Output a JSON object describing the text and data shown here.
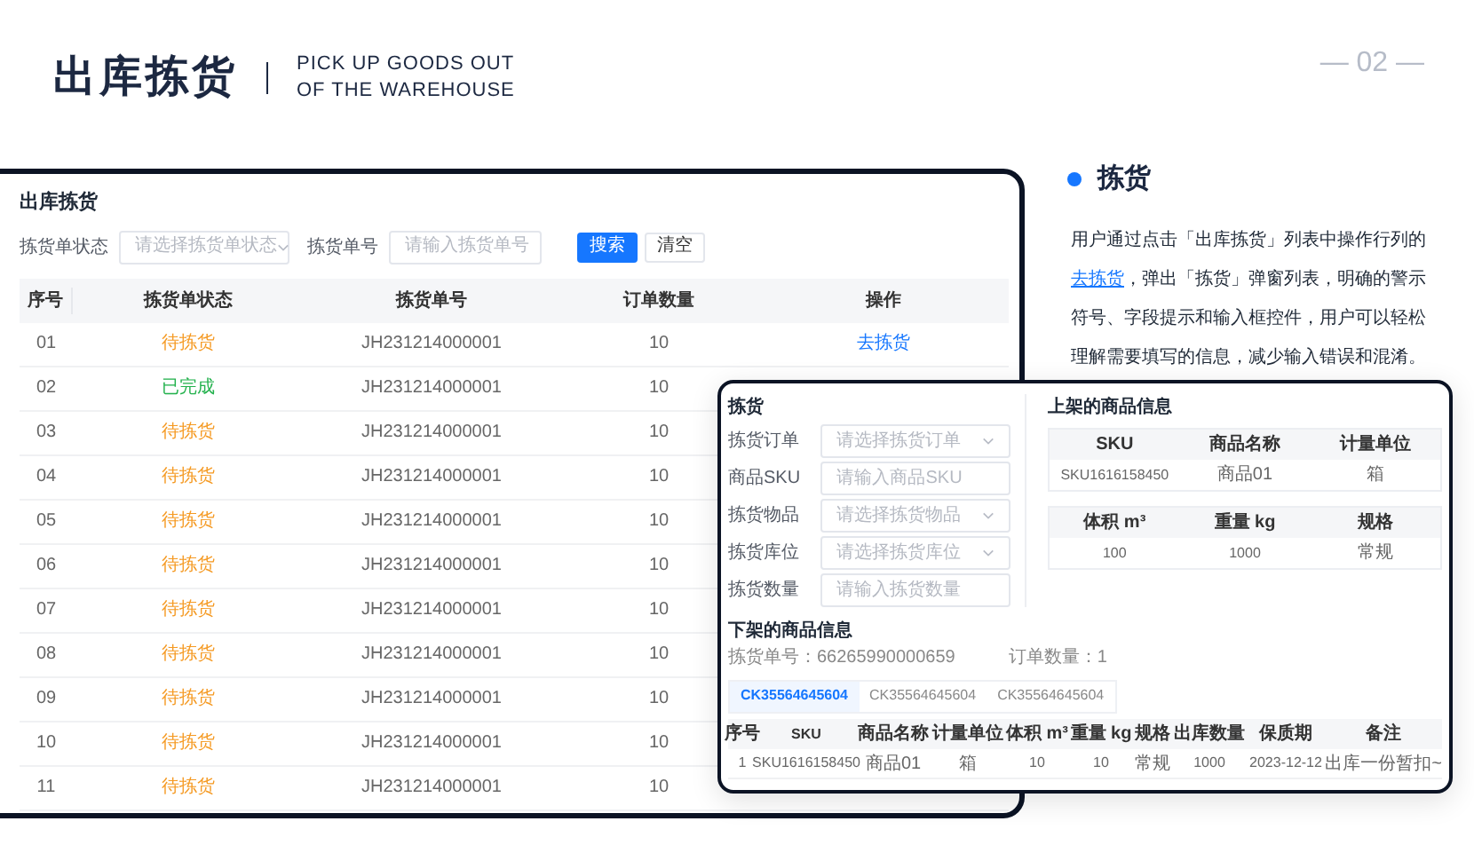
{
  "header": {
    "title": "出库拣货",
    "subtitle_lines": [
      "PICK UP GOODS OUT",
      "OF THE WAREHOUSE"
    ],
    "page_number": "— 02 —"
  },
  "list_window": {
    "title": "出库拣货",
    "filters": [
      {
        "kind": "select",
        "label": "拣货单状态",
        "placeholder": "请选择拣货单状态"
      },
      {
        "kind": "input",
        "label": "拣货单号",
        "placeholder": "请输入拣货单号"
      }
    ],
    "buttons": [
      {
        "label": "搜索",
        "kind": "primary"
      },
      {
        "label": "清空",
        "kind": "plain"
      }
    ],
    "columns": [
      "序号",
      "拣货单状态",
      "拣货单号",
      "订单数量",
      "操作"
    ],
    "rows": [
      {
        "index": "01",
        "status": "待拣货",
        "color": "#f59a23",
        "number": "JH231214000001",
        "count": "10",
        "action": "去拣货"
      },
      {
        "index": "02",
        "status": "已完成",
        "color": "#22b14c",
        "number": "JH231214000001",
        "count": "10"
      },
      {
        "index": "03",
        "status": "待拣货",
        "color": "#f59a23",
        "number": "JH231214000001",
        "count": "10"
      },
      {
        "index": "04",
        "status": "待拣货",
        "color": "#f59a23",
        "number": "JH231214000001",
        "count": "10"
      },
      {
        "index": "05",
        "status": "待拣货",
        "color": "#f59a23",
        "number": "JH231214000001",
        "count": "10"
      },
      {
        "index": "06",
        "status": "待拣货",
        "color": "#f59a23",
        "number": "JH231214000001",
        "count": "10"
      },
      {
        "index": "07",
        "status": "待拣货",
        "color": "#f59a23",
        "number": "JH231214000001",
        "count": "10"
      },
      {
        "index": "08",
        "status": "待拣货",
        "color": "#f59a23",
        "number": "JH231214000001",
        "count": "10"
      },
      {
        "index": "09",
        "status": "待拣货",
        "color": "#f59a23",
        "number": "JH231214000001",
        "count": "10"
      },
      {
        "index": "10",
        "status": "待拣货",
        "color": "#f59a23",
        "number": "JH231214000001",
        "count": "10"
      },
      {
        "index": "11",
        "status": "待拣货",
        "color": "#f59a23",
        "number": "JH231214000001",
        "count": "10"
      }
    ]
  },
  "pick_dialog": {
    "title": "拣货",
    "fields": [
      {
        "kind": "select",
        "label": "拣货订单",
        "placeholder": "请选择拣货订单"
      },
      {
        "kind": "input",
        "label": "商品SKU",
        "placeholder": "请输入商品SKU"
      },
      {
        "kind": "select",
        "label": "拣货物品",
        "placeholder": "请选择拣货物品"
      },
      {
        "kind": "select",
        "label": "拣货库位",
        "placeholder": "请选择拣货库位"
      },
      {
        "kind": "input",
        "label": "拣货数量",
        "placeholder": "请输入拣货数量"
      }
    ],
    "shelf_title": "上架的商品信息",
    "shelf_tables": [
      {
        "columns": [
          "SKU",
          "商品名称",
          "计量单位"
        ],
        "row": [
          "SKU1616158450",
          "商品01",
          "箱"
        ]
      },
      {
        "columns": [
          "体积 m³",
          "重量 kg",
          "规格"
        ],
        "row": [
          "100",
          "1000",
          "常规"
        ]
      }
    ],
    "down_title": "下架的商品信息",
    "meta": [
      "拣货单号：66265990000659",
      "订单数量：1"
    ],
    "tabs": [
      {
        "label": "CK35564645604",
        "selected": true
      },
      {
        "label": "CK35564645604",
        "selected": false
      },
      {
        "label": "CK35564645604",
        "selected": false
      }
    ],
    "columns": [
      "序号",
      "SKU",
      "商品名称",
      "计量单位",
      "体积 m³",
      "重量 kg",
      "规格",
      "出库数量",
      "保质期",
      "备注"
    ],
    "rows": [
      [
        "1",
        "SKU1616158450",
        "商品01",
        "箱",
        "10",
        "10",
        "常规",
        "1000",
        "2023-12-12",
        "出库一份暂扣~"
      ]
    ]
  },
  "feature": {
    "title": "拣货",
    "text_before": "用户通过点击「出库拣货」列表中操作行列的",
    "link": "去拣货",
    "text_after": "，弹出「拣货」弹窗列表，明确的警示符号、字段提示和输入框控件，用户可以轻松理解需要填写的信息，减少输入错误和混淆。"
  }
}
